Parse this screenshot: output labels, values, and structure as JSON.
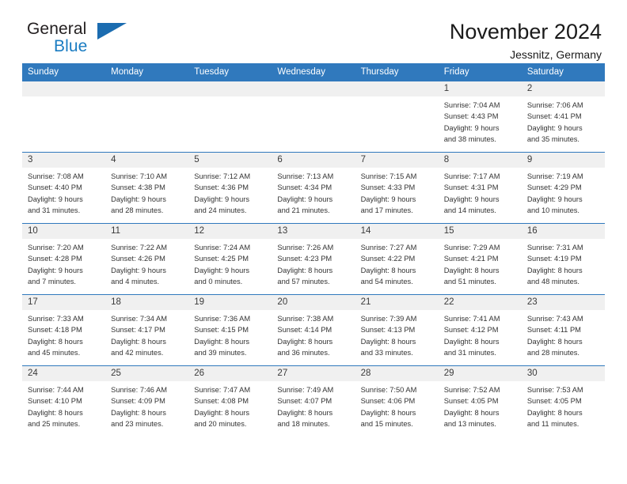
{
  "brand": {
    "name_top": "General",
    "name_bottom": "Blue",
    "accent_color": "#1b6cb0",
    "text_color": "#231f20"
  },
  "header": {
    "title": "November 2024",
    "subtitle": "Jessnitz, Germany"
  },
  "theme": {
    "header_bg": "#3079bd",
    "daynum_bg": "#f0f0f0",
    "row_border": "#3079bd"
  },
  "weekdays": [
    "Sunday",
    "Monday",
    "Tuesday",
    "Wednesday",
    "Thursday",
    "Friday",
    "Saturday"
  ],
  "weeks": [
    [
      {
        "day": "",
        "lines": []
      },
      {
        "day": "",
        "lines": []
      },
      {
        "day": "",
        "lines": []
      },
      {
        "day": "",
        "lines": []
      },
      {
        "day": "",
        "lines": []
      },
      {
        "day": "1",
        "lines": [
          "Sunrise: 7:04 AM",
          "Sunset: 4:43 PM",
          "Daylight: 9 hours",
          "and 38 minutes."
        ]
      },
      {
        "day": "2",
        "lines": [
          "Sunrise: 7:06 AM",
          "Sunset: 4:41 PM",
          "Daylight: 9 hours",
          "and 35 minutes."
        ]
      }
    ],
    [
      {
        "day": "3",
        "lines": [
          "Sunrise: 7:08 AM",
          "Sunset: 4:40 PM",
          "Daylight: 9 hours",
          "and 31 minutes."
        ]
      },
      {
        "day": "4",
        "lines": [
          "Sunrise: 7:10 AM",
          "Sunset: 4:38 PM",
          "Daylight: 9 hours",
          "and 28 minutes."
        ]
      },
      {
        "day": "5",
        "lines": [
          "Sunrise: 7:12 AM",
          "Sunset: 4:36 PM",
          "Daylight: 9 hours",
          "and 24 minutes."
        ]
      },
      {
        "day": "6",
        "lines": [
          "Sunrise: 7:13 AM",
          "Sunset: 4:34 PM",
          "Daylight: 9 hours",
          "and 21 minutes."
        ]
      },
      {
        "day": "7",
        "lines": [
          "Sunrise: 7:15 AM",
          "Sunset: 4:33 PM",
          "Daylight: 9 hours",
          "and 17 minutes."
        ]
      },
      {
        "day": "8",
        "lines": [
          "Sunrise: 7:17 AM",
          "Sunset: 4:31 PM",
          "Daylight: 9 hours",
          "and 14 minutes."
        ]
      },
      {
        "day": "9",
        "lines": [
          "Sunrise: 7:19 AM",
          "Sunset: 4:29 PM",
          "Daylight: 9 hours",
          "and 10 minutes."
        ]
      }
    ],
    [
      {
        "day": "10",
        "lines": [
          "Sunrise: 7:20 AM",
          "Sunset: 4:28 PM",
          "Daylight: 9 hours",
          "and 7 minutes."
        ]
      },
      {
        "day": "11",
        "lines": [
          "Sunrise: 7:22 AM",
          "Sunset: 4:26 PM",
          "Daylight: 9 hours",
          "and 4 minutes."
        ]
      },
      {
        "day": "12",
        "lines": [
          "Sunrise: 7:24 AM",
          "Sunset: 4:25 PM",
          "Daylight: 9 hours",
          "and 0 minutes."
        ]
      },
      {
        "day": "13",
        "lines": [
          "Sunrise: 7:26 AM",
          "Sunset: 4:23 PM",
          "Daylight: 8 hours",
          "and 57 minutes."
        ]
      },
      {
        "day": "14",
        "lines": [
          "Sunrise: 7:27 AM",
          "Sunset: 4:22 PM",
          "Daylight: 8 hours",
          "and 54 minutes."
        ]
      },
      {
        "day": "15",
        "lines": [
          "Sunrise: 7:29 AM",
          "Sunset: 4:21 PM",
          "Daylight: 8 hours",
          "and 51 minutes."
        ]
      },
      {
        "day": "16",
        "lines": [
          "Sunrise: 7:31 AM",
          "Sunset: 4:19 PM",
          "Daylight: 8 hours",
          "and 48 minutes."
        ]
      }
    ],
    [
      {
        "day": "17",
        "lines": [
          "Sunrise: 7:33 AM",
          "Sunset: 4:18 PM",
          "Daylight: 8 hours",
          "and 45 minutes."
        ]
      },
      {
        "day": "18",
        "lines": [
          "Sunrise: 7:34 AM",
          "Sunset: 4:17 PM",
          "Daylight: 8 hours",
          "and 42 minutes."
        ]
      },
      {
        "day": "19",
        "lines": [
          "Sunrise: 7:36 AM",
          "Sunset: 4:15 PM",
          "Daylight: 8 hours",
          "and 39 minutes."
        ]
      },
      {
        "day": "20",
        "lines": [
          "Sunrise: 7:38 AM",
          "Sunset: 4:14 PM",
          "Daylight: 8 hours",
          "and 36 minutes."
        ]
      },
      {
        "day": "21",
        "lines": [
          "Sunrise: 7:39 AM",
          "Sunset: 4:13 PM",
          "Daylight: 8 hours",
          "and 33 minutes."
        ]
      },
      {
        "day": "22",
        "lines": [
          "Sunrise: 7:41 AM",
          "Sunset: 4:12 PM",
          "Daylight: 8 hours",
          "and 31 minutes."
        ]
      },
      {
        "day": "23",
        "lines": [
          "Sunrise: 7:43 AM",
          "Sunset: 4:11 PM",
          "Daylight: 8 hours",
          "and 28 minutes."
        ]
      }
    ],
    [
      {
        "day": "24",
        "lines": [
          "Sunrise: 7:44 AM",
          "Sunset: 4:10 PM",
          "Daylight: 8 hours",
          "and 25 minutes."
        ]
      },
      {
        "day": "25",
        "lines": [
          "Sunrise: 7:46 AM",
          "Sunset: 4:09 PM",
          "Daylight: 8 hours",
          "and 23 minutes."
        ]
      },
      {
        "day": "26",
        "lines": [
          "Sunrise: 7:47 AM",
          "Sunset: 4:08 PM",
          "Daylight: 8 hours",
          "and 20 minutes."
        ]
      },
      {
        "day": "27",
        "lines": [
          "Sunrise: 7:49 AM",
          "Sunset: 4:07 PM",
          "Daylight: 8 hours",
          "and 18 minutes."
        ]
      },
      {
        "day": "28",
        "lines": [
          "Sunrise: 7:50 AM",
          "Sunset: 4:06 PM",
          "Daylight: 8 hours",
          "and 15 minutes."
        ]
      },
      {
        "day": "29",
        "lines": [
          "Sunrise: 7:52 AM",
          "Sunset: 4:05 PM",
          "Daylight: 8 hours",
          "and 13 minutes."
        ]
      },
      {
        "day": "30",
        "lines": [
          "Sunrise: 7:53 AM",
          "Sunset: 4:05 PM",
          "Daylight: 8 hours",
          "and 11 minutes."
        ]
      }
    ]
  ]
}
